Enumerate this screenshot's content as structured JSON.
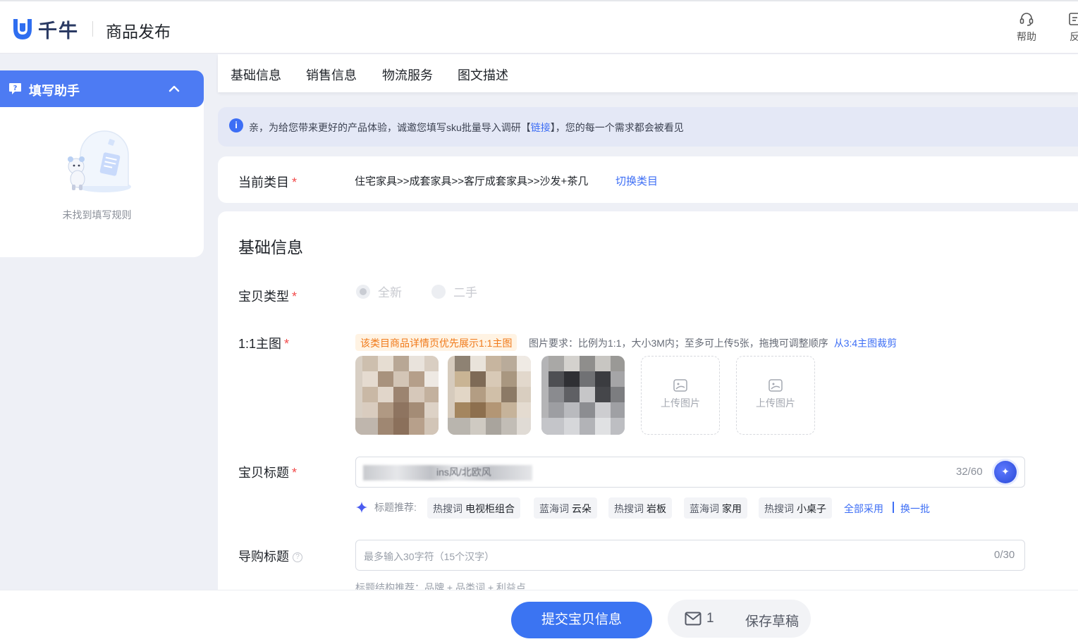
{
  "header": {
    "logo_text": "千牛",
    "page_name": "商品发布",
    "tools": [
      {
        "label": "帮助",
        "icon": "headset-icon"
      },
      {
        "label": "反",
        "icon": "feedback-icon"
      }
    ]
  },
  "assistant": {
    "title": "填写助手",
    "empty_text": "未找到填写规则"
  },
  "tabs": [
    "基础信息",
    "销售信息",
    "物流服务",
    "图文描述"
  ],
  "notice": {
    "text_before": "亲，为给您带来更好的产品体验，诚邀您填写sku批量导入调研【",
    "link": "链接",
    "text_after": "】，您的每一个需求都会被看见"
  },
  "category": {
    "label": "当前类目",
    "required_mark": "*",
    "path": "住宅家具>>成套家具>>客厅成套家具>>沙发+茶几",
    "switch_label": "切换类目"
  },
  "form": {
    "section_title": "基础信息",
    "item_type": {
      "label": "宝贝类型",
      "required_mark": "*",
      "options": [
        "全新",
        "二手"
      ],
      "selected": "全新"
    },
    "main_image": {
      "label": "1:1主图",
      "required_mark": "*",
      "tip": "该类目商品详情页优先展示1:1主图",
      "requirement": "图片要求：比例为1:1，大小3M内；至多可上传5张，拖拽可调整顺序",
      "crop_link": "从3:4主图裁剪",
      "upload_label": "上传图片"
    },
    "title": {
      "label": "宝贝标题",
      "required_mark": "*",
      "value_visible": "ins风/北欧风",
      "count": "32/60"
    },
    "suggestions": {
      "label": "标题推荐:",
      "chips": [
        {
          "kind": "热搜词",
          "word": "电视柜组合"
        },
        {
          "kind": "蓝海词",
          "word": "云朵"
        },
        {
          "kind": "热搜词",
          "word": "岩板"
        },
        {
          "kind": "蓝海词",
          "word": "家用"
        },
        {
          "kind": "热搜词",
          "word": "小桌子"
        }
      ],
      "adopt_all": "全部采用",
      "refresh": "换一批"
    },
    "guide_title": {
      "label": "导购标题",
      "placeholder": "最多输入30字符（15个汉字）",
      "count": "0/30",
      "structure_tip": "标题结构推荐：品牌 + 品类词 + 利益点"
    }
  },
  "footer": {
    "submit_label": "提交宝贝信息",
    "draft_count": "1",
    "draft_label": "保存草稿"
  },
  "colors": {
    "primary": "#3b74f2",
    "assistant_bar": "#4d7bf3",
    "required": "#f24b4b",
    "tip_orange": "#f07a1a",
    "link": "#3d6ef5"
  }
}
